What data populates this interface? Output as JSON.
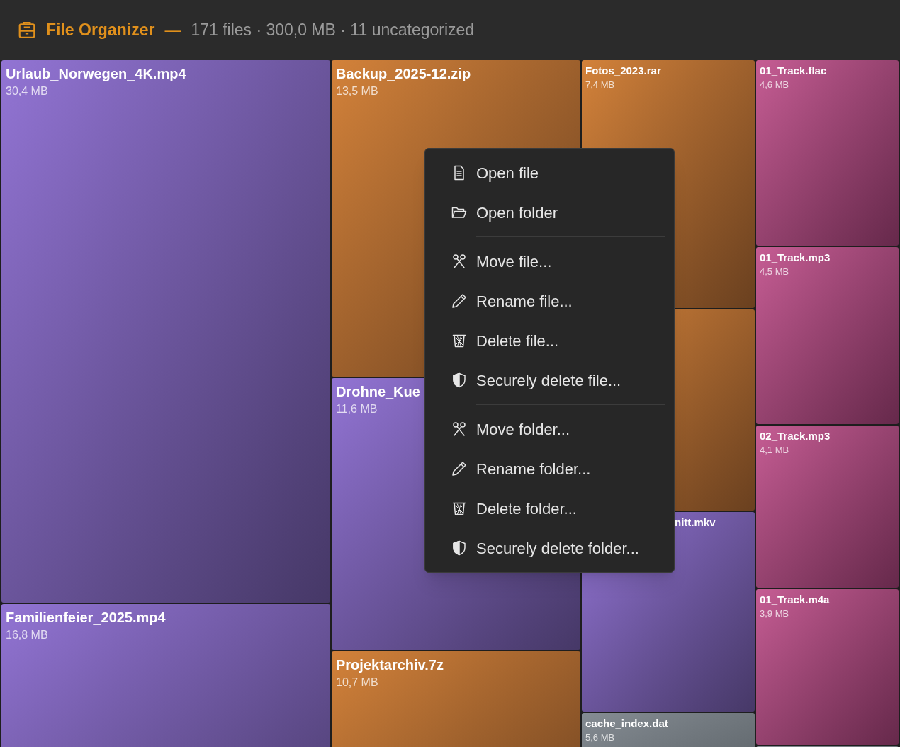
{
  "header": {
    "title": "File Organizer",
    "separator": "—",
    "summary": "171 files · 300,0 MB · 11 uncategorized"
  },
  "treemap": {
    "columns": [
      {
        "tiles": [
          {
            "kind": "video",
            "name": "Urlaub_Norwegen_4K.mp4",
            "size": "30,4 MB"
          },
          {
            "kind": "video",
            "name": "Familienfeier_2025.mp4",
            "size": "16,8 MB"
          }
        ]
      },
      {
        "tiles": [
          {
            "kind": "archive",
            "name": "Backup_2025-12.zip",
            "size": "13,5 MB"
          },
          {
            "kind": "video",
            "name": "Drohne_Kue",
            "size": "11,6 MB"
          },
          {
            "kind": "archive",
            "name": "Projektarchiv.7z",
            "size": "10,7 MB"
          }
        ]
      },
      {
        "tiles": [
          {
            "kind": "archive",
            "name": "Fotos_2023.rar",
            "size": "7,4 MB"
          },
          {
            "kind": "archive"
          },
          {
            "kind": "video",
            "name": "nitt.mkv"
          },
          {
            "kind": "other",
            "name": "cache_index.dat",
            "size": "5,6 MB"
          }
        ]
      },
      {
        "tiles": [
          {
            "kind": "audio",
            "name": "01_Track.flac",
            "size": "4,6 MB"
          },
          {
            "kind": "audio",
            "name": "01_Track.mp3",
            "size": "4,5 MB"
          },
          {
            "kind": "audio",
            "name": "02_Track.mp3",
            "size": "4,1 MB"
          },
          {
            "kind": "audio",
            "name": "01_Track.m4a",
            "size": "3,9 MB"
          },
          {
            "kind": "other"
          }
        ]
      }
    ]
  },
  "context_menu": {
    "items": [
      {
        "kind": "document",
        "label": "Open file",
        "divider_before": false
      },
      {
        "kind": "folder",
        "label": "Open folder",
        "divider_before": false
      },
      {
        "kind": "move",
        "label": "Move file...",
        "divider_before": true
      },
      {
        "kind": "rename",
        "label": "Rename file...",
        "divider_before": false
      },
      {
        "kind": "delete",
        "label": "Delete file...",
        "divider_before": false
      },
      {
        "kind": "secure",
        "label": "Securely delete file...",
        "divider_before": false
      },
      {
        "kind": "move",
        "label": "Move folder...",
        "divider_before": true
      },
      {
        "kind": "rename",
        "label": "Rename folder...",
        "divider_before": false
      },
      {
        "kind": "delete",
        "label": "Delete folder...",
        "divider_before": false
      },
      {
        "kind": "secure",
        "label": "Securely delete folder...",
        "divider_before": false
      }
    ]
  }
}
